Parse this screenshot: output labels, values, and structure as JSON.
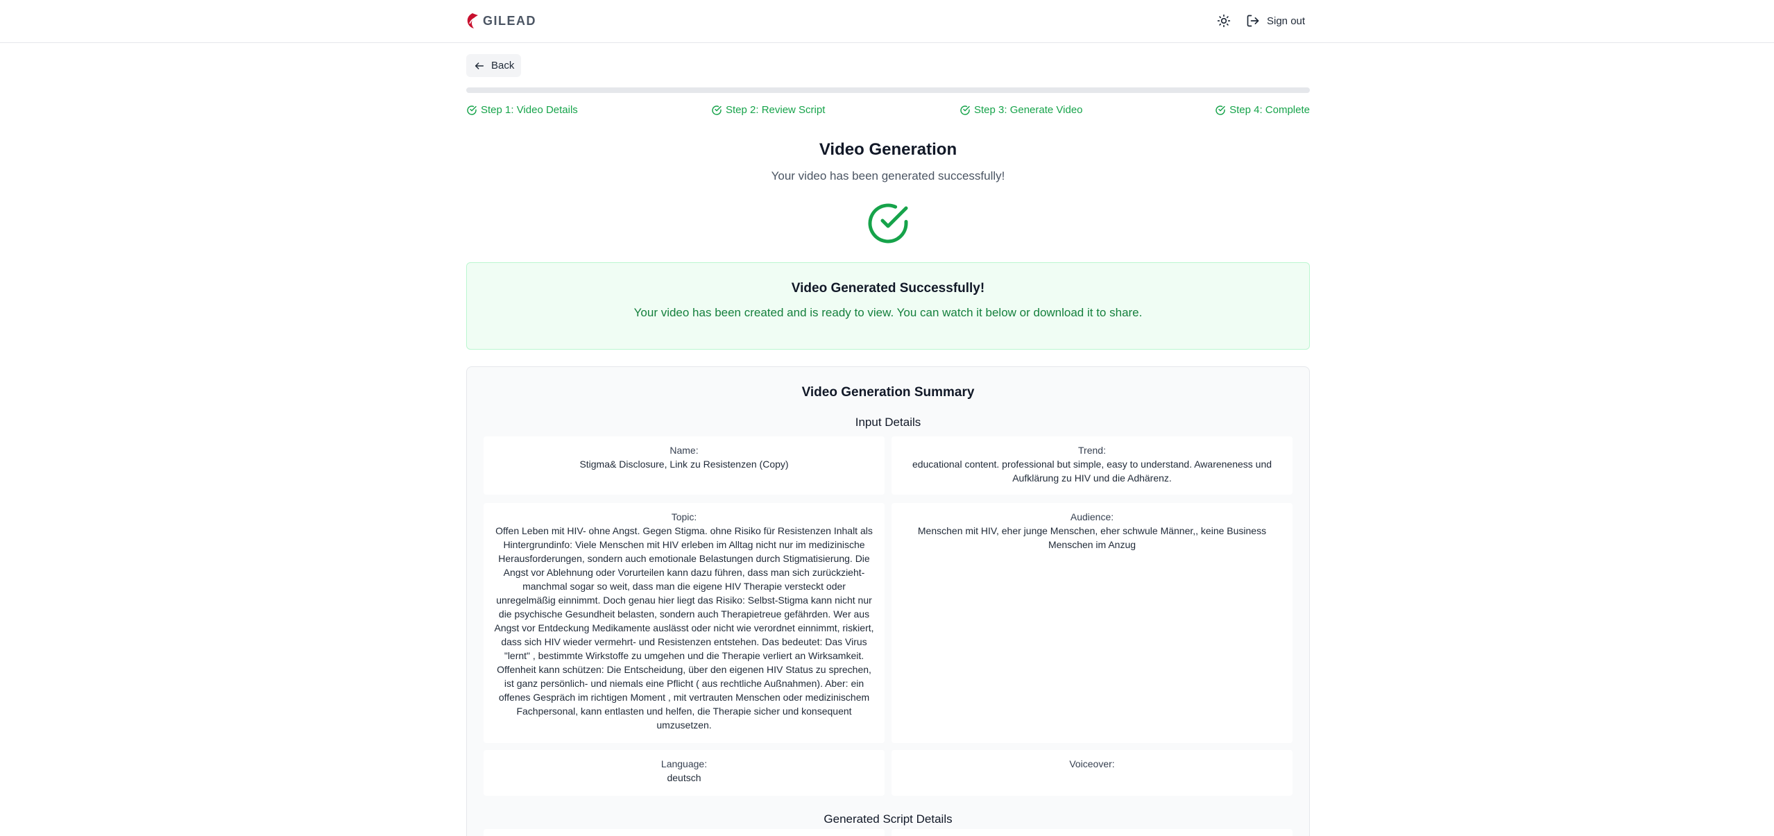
{
  "header": {
    "logo_text": "GILEAD",
    "theme_icon": "sun-icon",
    "signout_icon": "sign-out-icon",
    "signout_label": "Sign out"
  },
  "back": {
    "label": "Back",
    "icon": "arrow-left-icon"
  },
  "progress": {
    "fraction": 1.0
  },
  "steps": [
    {
      "label": "Step 1: Video Details"
    },
    {
      "label": "Step 2: Review Script"
    },
    {
      "label": "Step 3: Generate Video"
    },
    {
      "label": "Step 4: Complete"
    }
  ],
  "page": {
    "title": "Video Generation",
    "subtitle": "Your video has been generated successfully!"
  },
  "success": {
    "title": "Video Generated Successfully!",
    "message": "Your video has been created and is ready to view. You can watch it below or download it to share."
  },
  "summary": {
    "title": "Video Generation Summary",
    "input_title": "Input Details",
    "script_title": "Generated Script Details",
    "name_label": "Name:",
    "name_value": "Stigma& Disclosure, Link zu Resistenzen (Copy)",
    "trend_label": "Trend:",
    "trend_value": "educational content. professional but simple, easy to understand. Awareneness und Aufklärung zu HIV und die Adhärenz.",
    "topic_label": "Topic:",
    "topic_value": "Offen Leben mit HIV- ohne Angst. Gegen Stigma. ohne Risiko für Resistenzen Inhalt als Hintergrundinfo: Viele Menschen mit HIV erleben im Alltag nicht nur im medizinische Herausforderungen, sondern auch emotionale Belastungen durch Stigmatisierung. Die Angst vor Ablehnung oder Vorurteilen kann dazu führen, dass man sich zurückzieht- manchmal sogar so weit, dass man die eigene HIV Therapie versteckt oder unregelmäßig einnimmt. Doch genau hier liegt das Risiko: Selbst-Stigma kann nicht nur die psychische Gesundheit belasten, sondern auch Therapietreue gefährden. Wer aus Angst vor Entdeckung Medikamente auslässt oder nicht wie verordnet einnimmt, riskiert, dass sich HIV wieder vermehrt- und Resistenzen entstehen. Das bedeutet: Das Virus \"lernt\" , bestimmte Wirkstoffe zu umgehen und die Therapie verliert an Wirksamkeit. Offenheit kann schützen: Die Entscheidung, über den eigenen HIV Status zu sprechen, ist ganz persönlich- und niemals eine Pflicht ( aus rechtliche Außnahmen). Aber: ein offenes Gespräch im richtigen Moment , mit vertrauten Menschen oder medizinischem Fachpersonal, kann entlasten und helfen, die Therapie sicher und konsequent umzusetzen.",
    "audience_label": "Audience:",
    "audience_value": "Menschen mit HIV, eher junge Menschen, eher schwule Männer,, keine Business Menschen im Anzug",
    "language_label": "Language:",
    "language_value": "deutsch",
    "voiceover_label": "Voiceover:",
    "voiceover_value": ""
  },
  "colors": {
    "success_green": "#16a34a",
    "success_bg": "#f0fdf4",
    "brand_red": "#c8102e"
  }
}
